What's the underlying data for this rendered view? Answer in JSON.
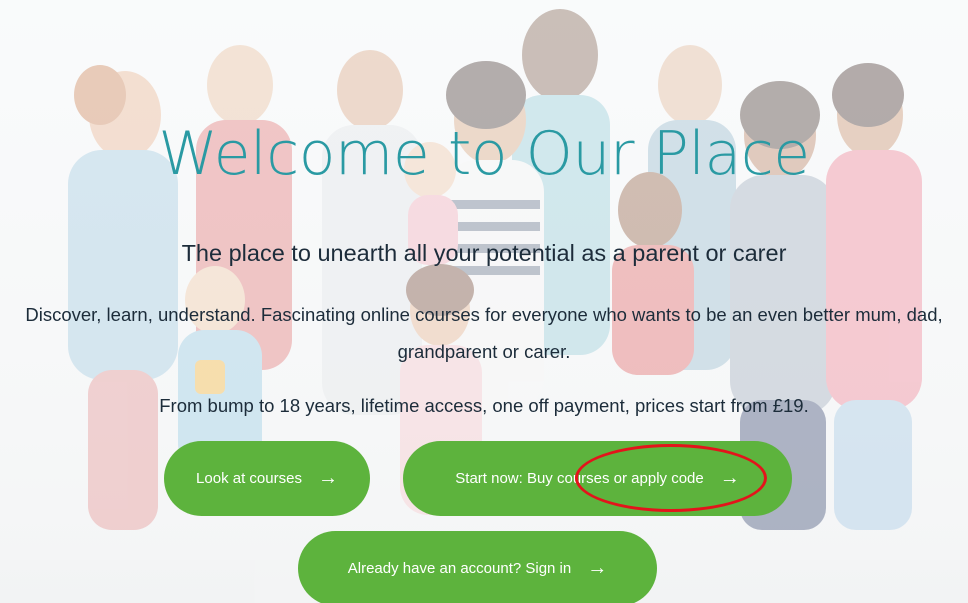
{
  "hero": {
    "title": "Welcome to Our Place",
    "subtitle": "The place to unearth all your potential as a parent or carer",
    "description": "Discover, learn, understand. Fascinating online courses for everyone who wants to be an even better mum, dad, grandparent or carer.",
    "pricing": "From bump to 18 years, lifetime access, one off payment, prices start from £19."
  },
  "buttons": {
    "look_at_courses": "Look at courses",
    "start_now": "Start now: Buy courses or apply code",
    "sign_in": "Already have an account? Sign in",
    "arrow_icon": "arrow-right-icon",
    "color": "#5db33d"
  },
  "colors": {
    "title": "#2a9aa3",
    "text": "#1c2c3a",
    "annotation": "#e3141b"
  }
}
